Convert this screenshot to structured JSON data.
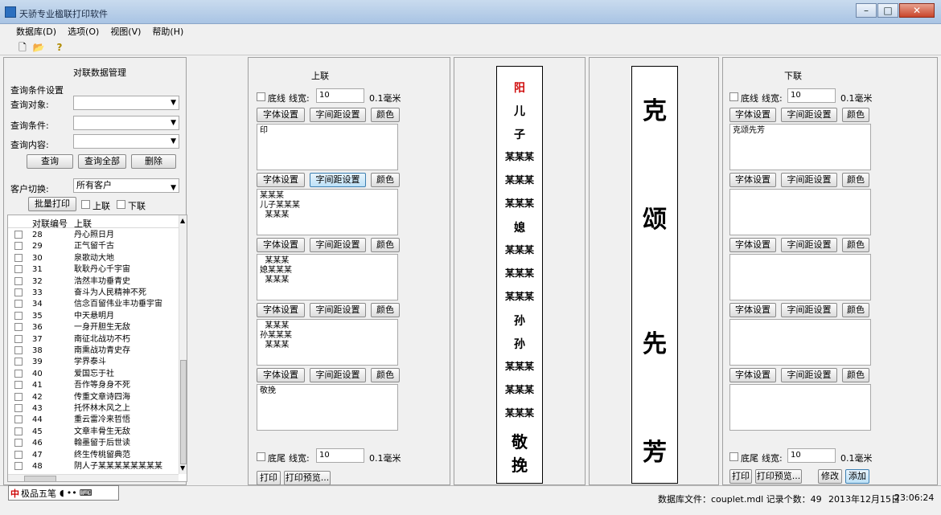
{
  "window": {
    "title": "天骄专业楹联打印软件"
  },
  "menu": [
    "数据库(D)",
    "选项(O)",
    "视图(V)",
    "帮助(H)"
  ],
  "toolbar": {
    "new": "🗋",
    "open": "📂",
    "help": "?"
  },
  "left": {
    "title": "对联数据管理",
    "query_group": "查询条件设置",
    "query_object_label": "查询对象:",
    "query_condition_label": "查询条件:",
    "query_content_label": "查询内容:",
    "btn_query": "查询",
    "btn_query_all": "查询全部",
    "btn_delete": "删除",
    "customer_label": "客户切换:",
    "customer_value": "所有客户",
    "batch_print": "批量打印",
    "chk_upper": "上联",
    "chk_lower": "下联",
    "list_headers": [
      "对联编号",
      "上联"
    ],
    "rows": [
      {
        "n": "28",
        "t": "丹心照日月"
      },
      {
        "n": "29",
        "t": "正气留千古"
      },
      {
        "n": "30",
        "t": "泉歌动大地"
      },
      {
        "n": "31",
        "t": "耿耿丹心千宇宙"
      },
      {
        "n": "32",
        "t": "浩然丰功垂青史"
      },
      {
        "n": "33",
        "t": "奋斗为人民精神不死"
      },
      {
        "n": "34",
        "t": "信念百留伟业丰功垂宇宙"
      },
      {
        "n": "35",
        "t": "中天悬明月"
      },
      {
        "n": "36",
        "t": "一身开胆生无敌"
      },
      {
        "n": "37",
        "t": "南征北战功不朽"
      },
      {
        "n": "38",
        "t": "南熏战功青史存"
      },
      {
        "n": "39",
        "t": "学界泰斗"
      },
      {
        "n": "40",
        "t": "爱国忘于社"
      },
      {
        "n": "41",
        "t": "吾作等身身不死"
      },
      {
        "n": "42",
        "t": "传重文章诗四海"
      },
      {
        "n": "43",
        "t": "托怀林木风之上"
      },
      {
        "n": "44",
        "t": "重云雷冷来哲悟"
      },
      {
        "n": "45",
        "t": "文章丰骨生无敌"
      },
      {
        "n": "46",
        "t": "翰墨留于后世读"
      },
      {
        "n": "47",
        "t": "终生传桃留典范"
      },
      {
        "n": "48",
        "t": "阴人子某某某某某某某某"
      }
    ]
  },
  "upper": {
    "title": "上联",
    "border_chk": "底线",
    "linewidth_label": "线宽:",
    "linewidth_value": "10",
    "unit": "0.1毫米",
    "font_btn": "字体设置",
    "spacing_btn": "字间距设置",
    "color_btn": "颜色",
    "boxes": [
      "印",
      "某某某\n儿子某某某\n  某某某",
      "  某某某\n媳某某某\n  某某某",
      "  某某某\n孙某某某\n  某某某",
      "敬挽"
    ],
    "tail_chk": "底尾",
    "tail_linewidth": "10",
    "print_btn": "打印",
    "preview_btn": "打印预览..."
  },
  "couplet_left": {
    "chars": [
      "阳",
      "儿",
      "子",
      "某某某",
      "某某某",
      "某某某",
      "媳",
      "某某某",
      "某某某",
      "某某某",
      "孙",
      "孙",
      "某某某",
      "某某某",
      "某某某",
      "敬",
      "挽"
    ]
  },
  "couplet_right": {
    "chars": [
      "克",
      "颂",
      "先",
      "芳"
    ]
  },
  "lower": {
    "title": "下联",
    "border_chk": "底线",
    "linewidth_label": "线宽:",
    "linewidth_value": "10",
    "unit": "0.1毫米",
    "font_btn": "字体设置",
    "spacing_btn": "字间距设置",
    "color_btn": "颜色",
    "box1": "克颂先芳",
    "tail_chk": "底尾",
    "tail_linewidth": "10",
    "print_btn": "打印",
    "preview_btn": "打印预览...",
    "modify_btn": "修改",
    "add_btn": "添加"
  },
  "status": {
    "db": "数据库文件：couplet.mdl 记录个数：49",
    "date": "2013年12月15日",
    "time": "23:06:24",
    "ime": "极品五笔"
  },
  "colors": {
    "upper_red": "#d01010",
    "couplet_ink": "#000000"
  }
}
